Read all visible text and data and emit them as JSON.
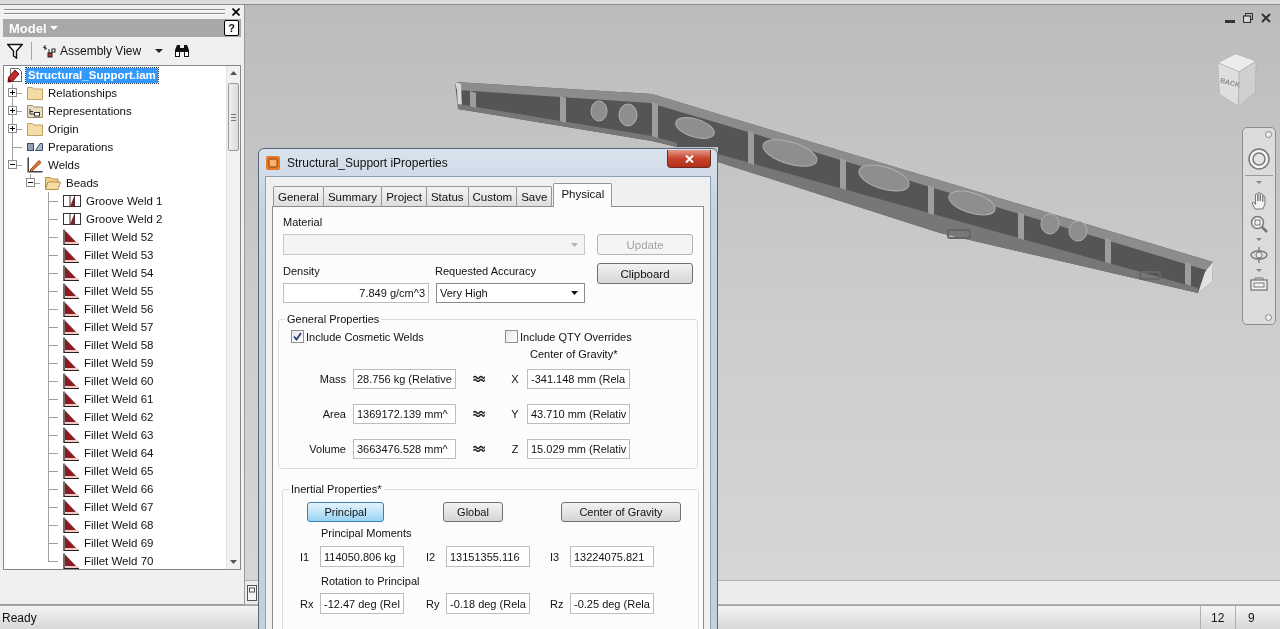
{
  "model_panel": {
    "title": "Model",
    "help_button": "?",
    "view": "Assembly View",
    "tree": [
      {
        "label": "Structural_Support.iam",
        "kind": "assembly",
        "selected": true,
        "children": [
          {
            "label": "Relationships",
            "kind": "folder",
            "expanded": false,
            "selected": false
          },
          {
            "label": "Representations",
            "kind": "representations",
            "expanded": false,
            "selected": false
          },
          {
            "label": "Origin",
            "kind": "folder",
            "expanded": false,
            "selected": false
          },
          {
            "label": "Preparations",
            "kind": "preparations",
            "selected": false
          },
          {
            "label": "Welds",
            "kind": "welds",
            "expanded": true,
            "selected": false,
            "children": [
              {
                "label": "Beads",
                "kind": "open-folder",
                "expanded": true,
                "selected": false,
                "children": [
                  {
                    "label": "Groove Weld 1",
                    "kind": "groove-weld",
                    "selected": false
                  },
                  {
                    "label": "Groove Weld 2",
                    "kind": "groove-weld",
                    "selected": false
                  },
                  {
                    "label": "Fillet Weld 52",
                    "kind": "fillet-weld",
                    "selected": false
                  },
                  {
                    "label": "Fillet Weld 53",
                    "kind": "fillet-weld",
                    "selected": false
                  },
                  {
                    "label": "Fillet Weld 54",
                    "kind": "fillet-weld",
                    "selected": false
                  },
                  {
                    "label": "Fillet Weld 55",
                    "kind": "fillet-weld",
                    "selected": false
                  },
                  {
                    "label": "Fillet Weld 56",
                    "kind": "fillet-weld",
                    "selected": false
                  },
                  {
                    "label": "Fillet Weld 57",
                    "kind": "fillet-weld",
                    "selected": false
                  },
                  {
                    "label": "Fillet Weld 58",
                    "kind": "fillet-weld",
                    "selected": false
                  },
                  {
                    "label": "Fillet Weld 59",
                    "kind": "fillet-weld",
                    "selected": false
                  },
                  {
                    "label": "Fillet Weld 60",
                    "kind": "fillet-weld",
                    "selected": false
                  },
                  {
                    "label": "Fillet Weld 61",
                    "kind": "fillet-weld",
                    "selected": false
                  },
                  {
                    "label": "Fillet Weld 62",
                    "kind": "fillet-weld",
                    "selected": false
                  },
                  {
                    "label": "Fillet Weld 63",
                    "kind": "fillet-weld",
                    "selected": false
                  },
                  {
                    "label": "Fillet Weld 64",
                    "kind": "fillet-weld",
                    "selected": false
                  },
                  {
                    "label": "Fillet Weld 65",
                    "kind": "fillet-weld",
                    "selected": false
                  },
                  {
                    "label": "Fillet Weld 66",
                    "kind": "fillet-weld",
                    "selected": false
                  },
                  {
                    "label": "Fillet Weld 67",
                    "kind": "fillet-weld",
                    "selected": false
                  },
                  {
                    "label": "Fillet Weld 68",
                    "kind": "fillet-weld",
                    "selected": false
                  },
                  {
                    "label": "Fillet Weld 69",
                    "kind": "fillet-weld",
                    "selected": false
                  },
                  {
                    "label": "Fillet Weld 70",
                    "kind": "fillet-weld",
                    "selected": false
                  }
                ]
              }
            ]
          }
        ]
      }
    ]
  },
  "viewport": {
    "view_cube": {
      "face_label": "BACK"
    }
  },
  "dialog": {
    "title": "Structural_Support iProperties",
    "tabs": [
      {
        "label": "General",
        "selected": false
      },
      {
        "label": "Summary",
        "selected": false
      },
      {
        "label": "Project",
        "selected": false
      },
      {
        "label": "Status",
        "selected": false
      },
      {
        "label": "Custom",
        "selected": false
      },
      {
        "label": "Save",
        "selected": false
      },
      {
        "label": "Physical",
        "selected": true
      }
    ],
    "material": {
      "label": "Material",
      "disabled": true
    },
    "update_button": {
      "label": "Update",
      "disabled": true
    },
    "density": {
      "label": "Density",
      "value": "7.849 g/cm^3"
    },
    "accuracy": {
      "label": "Requested Accuracy",
      "value": "Very High"
    },
    "clipboard_button": {
      "label": "Clipboard",
      "disabled": false
    },
    "general_properties": {
      "title": "General Properties",
      "options": [
        {
          "label": "Include Cosmetic Welds",
          "checked": true
        },
        {
          "label": "Include QTY Overrides",
          "checked": false
        }
      ],
      "center_heading": "Center of Gravity*",
      "rows": [
        {
          "label": "Mass",
          "value": "28.756 kg (Relative",
          "axis": "X",
          "axis_value": "-341.148 mm (Rela"
        },
        {
          "label": "Area",
          "value": "1369172.139 mm^",
          "axis": "Y",
          "axis_value": "43.710 mm (Relativ"
        },
        {
          "label": "Volume",
          "value": "3663476.528 mm^",
          "axis": "Z",
          "axis_value": "15.029 mm (Relativ"
        }
      ]
    },
    "inertial_properties": {
      "title": "Inertial Properties*",
      "modes": [
        {
          "label": "Principal",
          "selected": true
        },
        {
          "label": "Global",
          "selected": false
        },
        {
          "label": "Center of Gravity",
          "selected": false
        }
      ],
      "moments_heading": "Principal Moments",
      "moments": [
        {
          "label": "I1",
          "value": "114050.806 kg"
        },
        {
          "label": "I2",
          "value": "13151355.116"
        },
        {
          "label": "I3",
          "value": "13224075.821"
        }
      ],
      "rotation_heading": "Rotation to Principal",
      "rotations": [
        {
          "label": "Rx",
          "value": "-12.47 deg (Rel"
        },
        {
          "label": "Ry",
          "value": "-0.18 deg (Rela"
        },
        {
          "label": "Rz",
          "value": "-0.25 deg (Rela"
        }
      ]
    }
  },
  "status_bar": {
    "message": "Ready",
    "fields": [
      "12",
      "9"
    ]
  }
}
